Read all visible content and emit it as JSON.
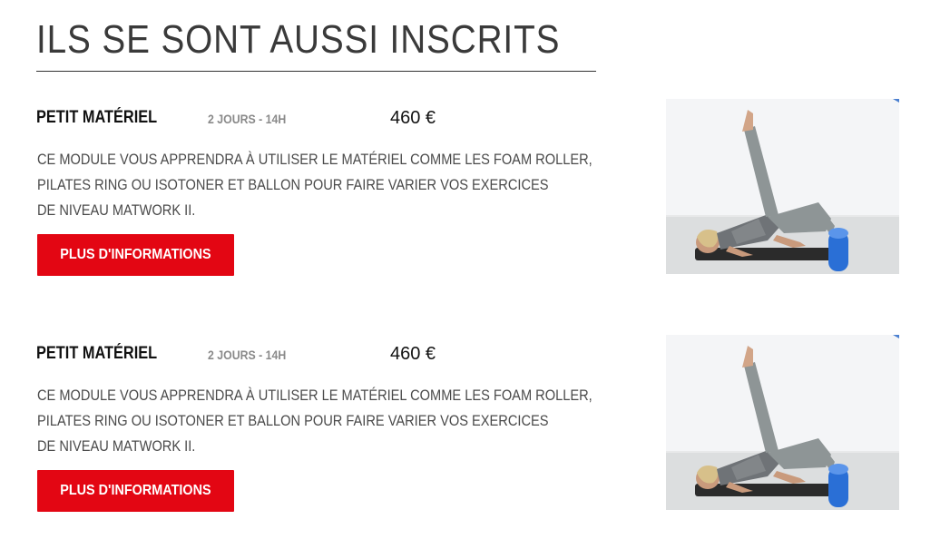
{
  "section": {
    "title": "ILS SE SONT AUSSI INSCRITS"
  },
  "courses": [
    {
      "name": "PETIT MATÉRIEL",
      "duration": "2 JOURS - 14H",
      "price": "460 €",
      "description": [
        "CE MODULE VOUS APPRENDRA À UTILISER LE MATÉRIEL COMME LES FOAM ROLLER,",
        "PILATES RING OU ISOTONER ET BALLON POUR FAIRE VARIER VOS EXERCICES",
        "DE NIVEAU MATWORK II."
      ],
      "button_label": "PLUS D'INFORMATIONS"
    },
    {
      "name": "PETIT MATÉRIEL",
      "duration": "2 JOURS - 14H",
      "price": "460 €",
      "description": [
        "CE MODULE VOUS APPRENDRA À UTILISER LE MATÉRIEL COMME LES FOAM ROLLER,",
        "PILATES RING OU ISOTONER ET BALLON POUR FAIRE VARIER VOS EXERCICES",
        "DE NIVEAU MATWORK II."
      ],
      "button_label": "PLUS D'INFORMATIONS"
    }
  ],
  "colors": {
    "accent": "#e30613",
    "text": "#222222",
    "muted": "#8a8a8a"
  }
}
